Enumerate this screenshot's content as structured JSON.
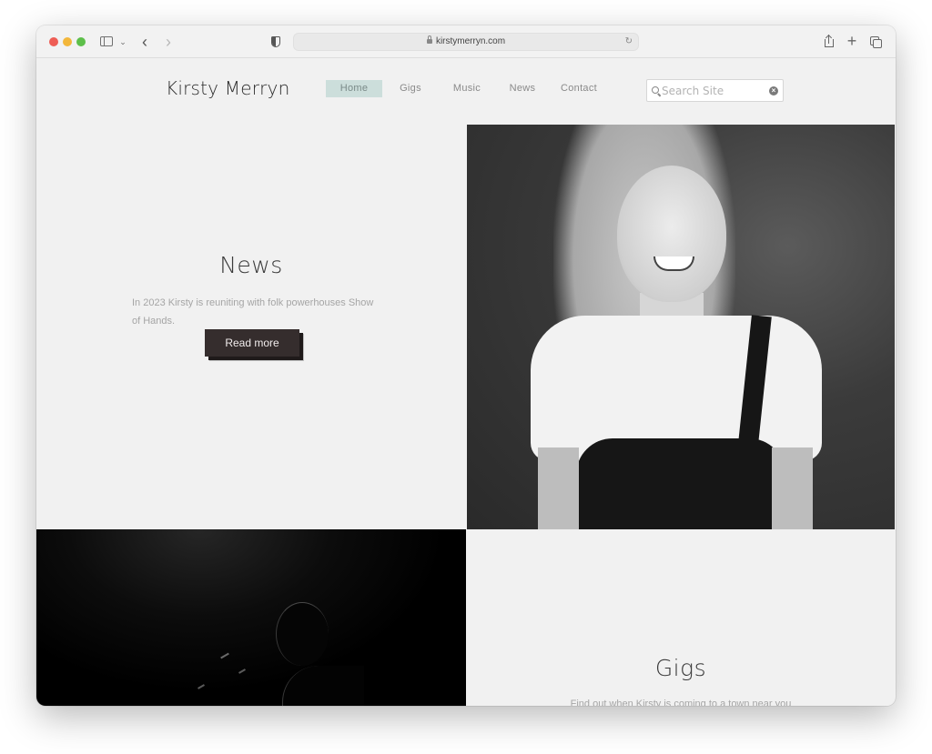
{
  "browser": {
    "url": "kirstymerryn.com",
    "traffic_lights": [
      "close",
      "minimize",
      "maximize"
    ],
    "colors": {
      "close": "#ee5d55",
      "minimize": "#f3b73b",
      "maximize": "#5dbf4a"
    },
    "icons": {
      "sidebar": "sidebar-icon",
      "chevron": "⌄",
      "back": "‹",
      "forward": "›",
      "reload": "↻",
      "plus": "+"
    }
  },
  "site": {
    "logo": "Kirsty Merryn",
    "nav": [
      {
        "label": "Home",
        "active": true
      },
      {
        "label": "Gigs",
        "active": false
      },
      {
        "label": "Music",
        "active": false
      },
      {
        "label": "News",
        "active": false
      },
      {
        "label": "Contact",
        "active": false
      }
    ],
    "accent_color": "#ccdedb",
    "search": {
      "placeholder": "Search Site",
      "value": "",
      "clear_glyph": "×"
    }
  },
  "news": {
    "title": "News",
    "text": "In 2023 Kirsty is reuniting with folk powerhouses Show of Hands.",
    "button_label": "Read more",
    "button_color": "#352d2d"
  },
  "gigs": {
    "title": "Gigs",
    "text": "Find out when Kirsty is coming to a town near you"
  },
  "images": {
    "portrait": "Black and white portrait of smiling woman with long blonde hair",
    "stage": "Dark stage photo of performer silhouette"
  }
}
